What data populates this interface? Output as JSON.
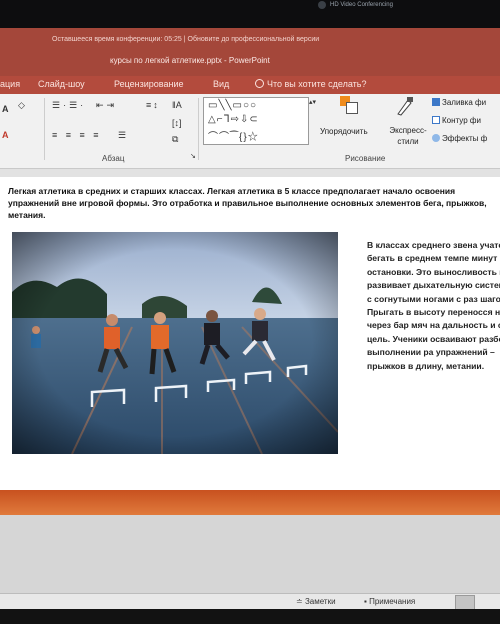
{
  "camera": {
    "label": "HD Video Conferencing"
  },
  "titlebar": {
    "line1": "Оставшееся время конференции: 05:25 | Обновите до профессиональной версии",
    "line2": "курсы по легкой атлетике.pptx - PowerPoint"
  },
  "menu": {
    "items": [
      "ация",
      "Слайд-шоу",
      "Рецензирование",
      "Вид"
    ],
    "tell_me": "Что вы хотите сделать?"
  },
  "ribbon": {
    "paragraph_label": "Абзац",
    "drawing_label": "Рисование",
    "arrange_label": "Упорядочить",
    "styles_label": "Экспресс-стили",
    "fill": "Заливка фи",
    "outline": "Контур фи",
    "effects": "Эффекты ф",
    "shape_rows": [
      "▭╲╲▭○○",
      "△⌐ᒣ⇨⇩⊂",
      "⌒⌒⁀{}☆"
    ],
    "left_glyphs": [
      "A",
      "A"
    ]
  },
  "slide": {
    "heading": "Легкая атлетика в средних и старших классах. Легкая атлетика в 5 классе предполагает начало освоения упражнений вне игровой формы. Это отработка и правильное выполнение основных элементов бега, прыжков, метания.",
    "body": "В классах среднего звена учатся бегать в среднем темпе минут без остановки. Это выносливость и развивает дыхательную систему. Пр с согнутыми ногами с раз шагов. Прыгать в высоту переносся ногу через бар мяч на дальность и с поп цель. Ученики осваивают разбега в выполнении ра упражнений – прыжков в длину, метании."
  },
  "statusbar": {
    "notes": "Заметки",
    "comments": "Примечания"
  },
  "colors": {
    "titlebar": "#a4473a",
    "menubar": "#b34b3d",
    "accent_band": "#d8642c"
  }
}
